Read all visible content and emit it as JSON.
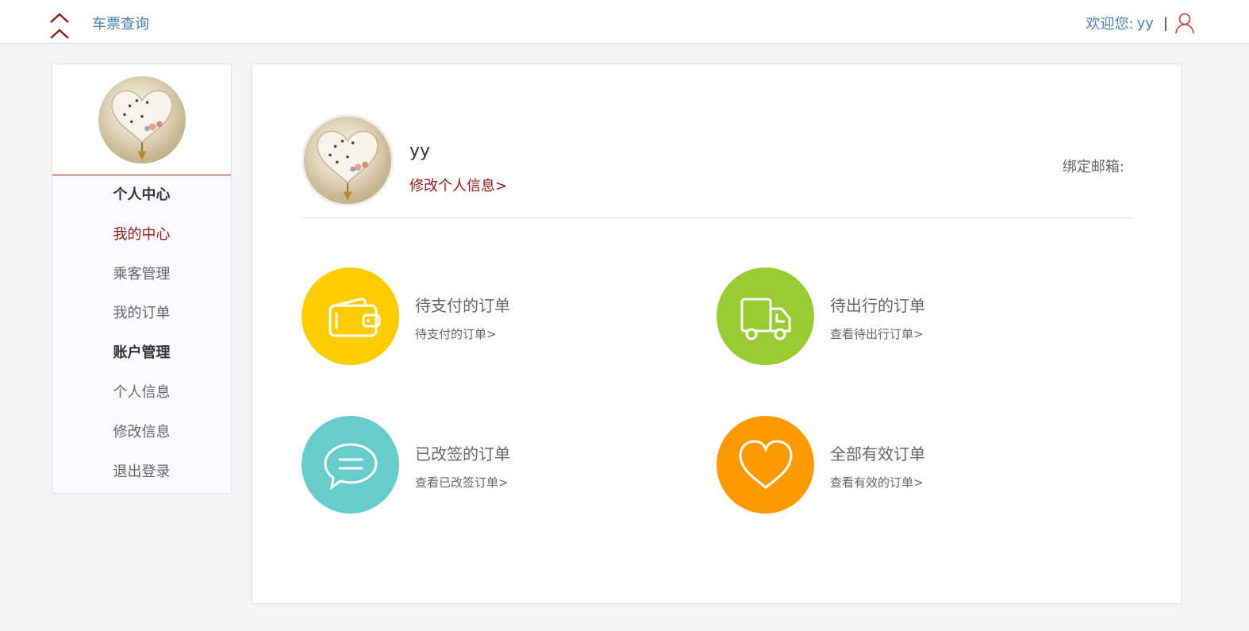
{
  "header": {
    "nav_link": "车票查询",
    "welcome_label": "欢迎您:",
    "username": "yy",
    "separator": "|"
  },
  "sidebar": {
    "items": [
      {
        "label": "个人中心",
        "type": "heading"
      },
      {
        "label": "我的中心",
        "type": "link",
        "active": true
      },
      {
        "label": "乘客管理",
        "type": "link"
      },
      {
        "label": "我的订单",
        "type": "link"
      },
      {
        "label": "账户管理",
        "type": "heading"
      },
      {
        "label": "个人信息",
        "type": "link"
      },
      {
        "label": "修改信息",
        "type": "link"
      },
      {
        "label": "退出登录",
        "type": "link"
      }
    ]
  },
  "profile": {
    "name": "yy",
    "edit_link": "修改个人信息>",
    "email_label": "绑定邮箱:"
  },
  "orders": [
    {
      "title": "待支付的订单",
      "link": "待支付的订单>",
      "icon": "wallet-icon",
      "color": "#ffcc00"
    },
    {
      "title": "待出行的订单",
      "link": "查看待出行订单>",
      "icon": "truck-icon",
      "color": "#99cc33"
    },
    {
      "title": "已改签的订单",
      "link": "查看已改签订单>",
      "icon": "chat-icon",
      "color": "#66cccc"
    },
    {
      "title": "全部有效订单",
      "link": "查看有效的订单>",
      "icon": "heart-icon",
      "color": "#ff9900"
    }
  ],
  "colors": {
    "accent": "#8b1a1a",
    "link_blue": "#4a7fb5",
    "background": "#f4f4f4"
  }
}
